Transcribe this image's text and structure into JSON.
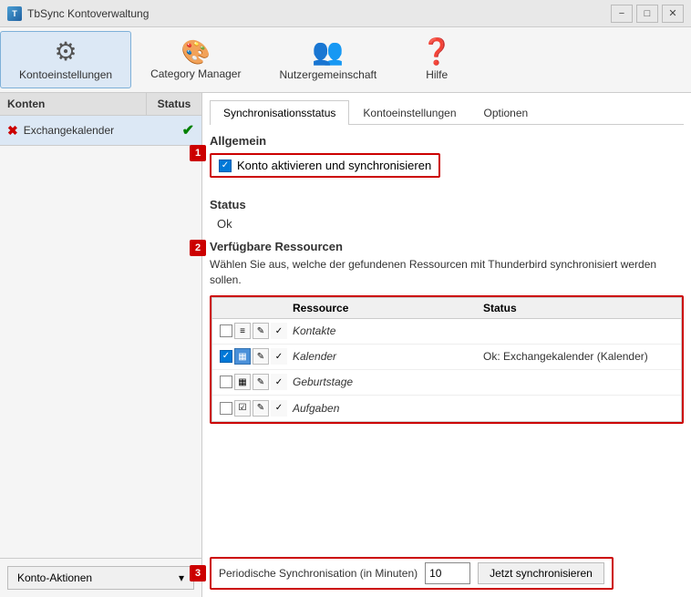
{
  "window": {
    "title": "TbSync Kontoverwaltung",
    "controls": {
      "minimize": "−",
      "maximize": "□",
      "close": "✕"
    }
  },
  "toolbar": {
    "buttons": [
      {
        "id": "kontoeinstellungen",
        "label": "Kontoeinstellungen",
        "icon": "⚙",
        "active": true
      },
      {
        "id": "category_manager",
        "label": "Category Manager",
        "icon": "🎨",
        "active": false
      },
      {
        "id": "nutzergemeinschaft",
        "label": "Nutzergemeinschaft",
        "icon": "👥",
        "active": false
      },
      {
        "id": "hilfe",
        "label": "Hilfe",
        "icon": "❓",
        "active": false
      }
    ]
  },
  "left_panel": {
    "header": {
      "col1": "Konten",
      "col2": "Status"
    },
    "accounts": [
      {
        "id": "exchangekalender",
        "name": "Exchangekalender",
        "has_error": true,
        "status": "ok"
      }
    ],
    "footer_btn": "Konto-Aktionen"
  },
  "right_panel": {
    "tabs": [
      {
        "id": "synchronisationsstatus",
        "label": "Synchronisationsstatus",
        "active": true
      },
      {
        "id": "kontoeinstellungen",
        "label": "Kontoeinstellungen",
        "active": false
      },
      {
        "id": "optionen",
        "label": "Optionen",
        "active": false
      }
    ],
    "allgemein": {
      "title": "Allgemein",
      "checkbox_label": "Konto aktivieren und synchronisieren",
      "checked": true
    },
    "status": {
      "title": "Status",
      "value": "Ok"
    },
    "resources": {
      "title": "Verfügbare Ressourcen",
      "description": "Wählen Sie aus, welche der gefundenen Ressourcen mit Thunderbird synchronisiert werden sollen.",
      "header": {
        "ressource": "Ressource",
        "status": "Status"
      },
      "rows": [
        {
          "checked": false,
          "icon": "📋",
          "name": "Kontakte",
          "status": "",
          "icon_type": "contacts"
        },
        {
          "checked": true,
          "icon": "📅",
          "name": "Kalender",
          "status": "Ok: Exchangekalender (Kalender)",
          "icon_type": "calendar"
        },
        {
          "checked": false,
          "icon": "📅",
          "name": "Geburtstage",
          "status": "",
          "icon_type": "calendar2"
        },
        {
          "checked": false,
          "icon": "📝",
          "name": "Aufgaben",
          "status": "",
          "icon_type": "tasks"
        }
      ]
    },
    "bottom": {
      "periodic_label": "Periodische Synchronisation (in Minuten)",
      "periodic_value": "10",
      "sync_btn": "Jetzt synchronisieren"
    }
  },
  "step_markers": {
    "step1": "1",
    "step2": "2",
    "step3": "3"
  }
}
